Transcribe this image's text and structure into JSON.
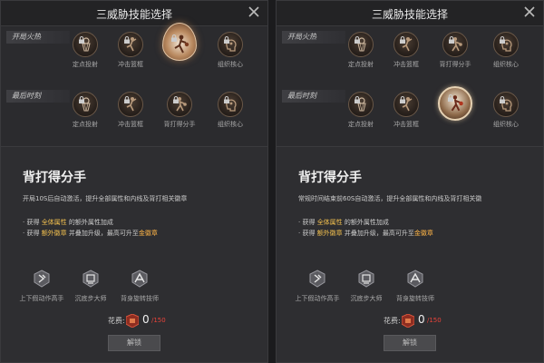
{
  "panels": [
    {
      "title": "三威胁技能选择",
      "sections": [
        {
          "label": "开局火热",
          "skills": [
            {
              "label": "定点投射",
              "icon": "basket-shot-icon",
              "locked": true,
              "selected": false
            },
            {
              "label": "冲击篮框",
              "icon": "dunk-icon",
              "locked": true,
              "selected": false
            },
            {
              "label": "",
              "icon": "fire-dribble-icon",
              "locked": true,
              "selected": true
            },
            {
              "label": "组织核心",
              "icon": "brain-icon",
              "locked": true,
              "selected": false
            }
          ]
        },
        {
          "label": "最后时刻",
          "skills": [
            {
              "label": "定点投射",
              "icon": "basket-shot-icon",
              "locked": true,
              "selected": false
            },
            {
              "label": "冲击篮框",
              "icon": "dunk-icon",
              "locked": true,
              "selected": false
            },
            {
              "label": "背打得分手",
              "icon": "post-up-icon",
              "locked": true,
              "selected": false
            },
            {
              "label": "组织核心",
              "icon": "brain-icon",
              "locked": true,
              "selected": false
            }
          ]
        }
      ],
      "detail": {
        "name": "背打得分手",
        "desc": "开局10S后自动激活，提升全部属性和内线及背打相关徽章",
        "bullet1": {
          "prefix": "· 获得 ",
          "hl": "全体属性",
          "suffix": " 的额外属性加成"
        },
        "bullet2": {
          "prefix": "· 获得 ",
          "hl": "额外徽章",
          "mid": " 并叠加升级，最高可升至",
          "hl2": "金徽章"
        }
      },
      "badges": [
        {
          "label": "上下假动作高手",
          "icon": "fake-move-icon"
        },
        {
          "label": "沉底步大师",
          "icon": "drop-step-icon"
        },
        {
          "label": "背身旋转技师",
          "icon": "spin-icon"
        }
      ],
      "cost": {
        "label": "花费:",
        "value": "0",
        "need": "/150",
        "icon": "gem-box-icon"
      },
      "unlock_label": "解锁"
    },
    {
      "title": "三威胁技能选择",
      "sections": [
        {
          "label": "开局火热",
          "skills": [
            {
              "label": "定点投射",
              "icon": "basket-shot-icon",
              "locked": true,
              "selected": false
            },
            {
              "label": "冲击篮框",
              "icon": "dunk-icon",
              "locked": true,
              "selected": false
            },
            {
              "label": "背打得分手",
              "icon": "post-up-icon",
              "locked": true,
              "selected": false
            },
            {
              "label": "组织核心",
              "icon": "brain-icon",
              "locked": true,
              "selected": false
            }
          ]
        },
        {
          "label": "最后时刻",
          "skills": [
            {
              "label": "定点投射",
              "icon": "basket-shot-icon",
              "locked": true,
              "selected": false
            },
            {
              "label": "冲击篮框",
              "icon": "dunk-icon",
              "locked": true,
              "selected": false
            },
            {
              "label": "",
              "icon": "post-up-icon",
              "locked": true,
              "selected": true
            },
            {
              "label": "组织核心",
              "icon": "brain-icon",
              "locked": true,
              "selected": false
            }
          ]
        }
      ],
      "detail": {
        "name": "背打得分手",
        "desc": "常规时间结束前60S自动激活，提升全部属性和内线及背打相关徽",
        "bullet1": {
          "prefix": "· 获得 ",
          "hl": "全体属性",
          "suffix": " 的额外属性加成"
        },
        "bullet2": {
          "prefix": "· 获得 ",
          "hl": "额外徽章",
          "mid": " 并叠加升级，最高可升至",
          "hl2": "金徽章"
        }
      },
      "badges": [
        {
          "label": "上下假动作高手",
          "icon": "fake-move-icon"
        },
        {
          "label": "沉底步大师",
          "icon": "drop-step-icon"
        },
        {
          "label": "背身旋转技师",
          "icon": "spin-icon"
        }
      ],
      "cost": {
        "label": "花费:",
        "value": "0",
        "need": "/150",
        "icon": "gem-box-icon"
      },
      "unlock_label": "解锁"
    }
  ]
}
